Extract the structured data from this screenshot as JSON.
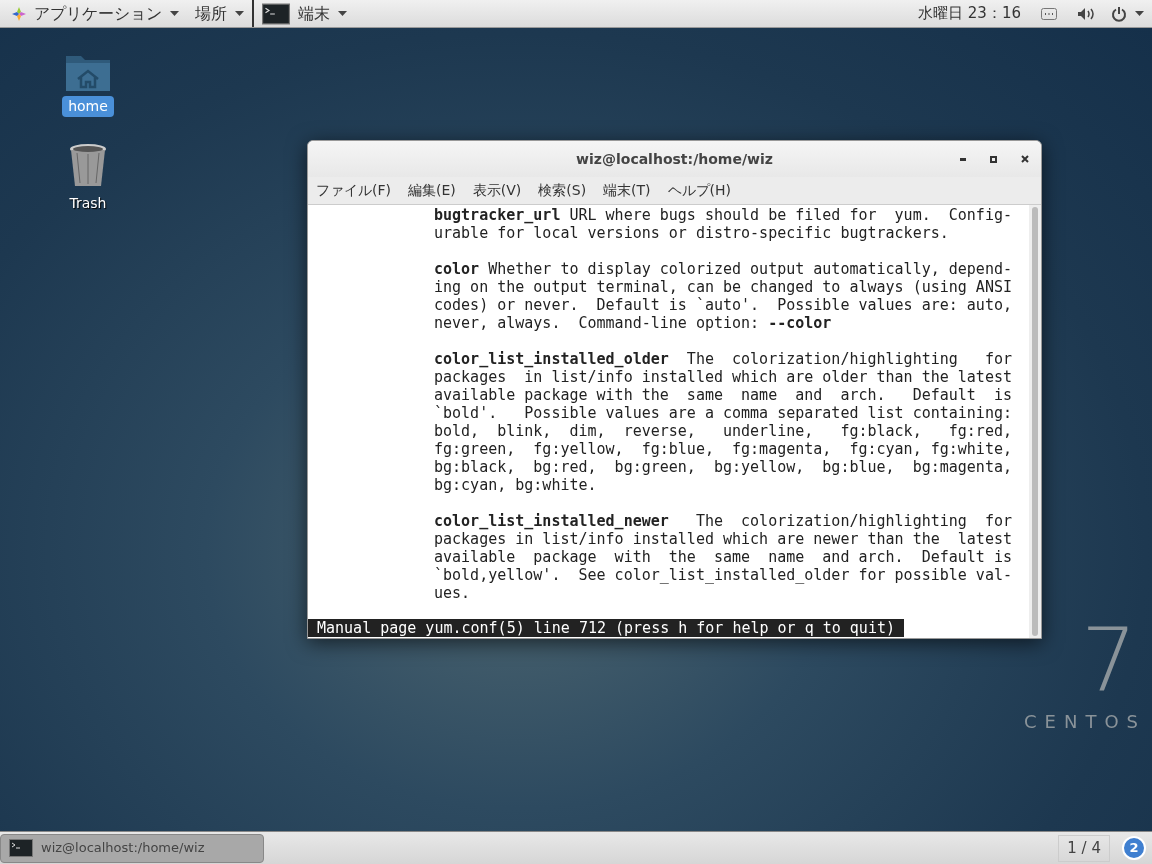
{
  "top_bar": {
    "menus": [
      {
        "label": "アプリケーション",
        "kind": "apps"
      },
      {
        "label": "場所",
        "kind": "plain"
      },
      {
        "label": "端末",
        "kind": "app"
      }
    ],
    "clock": "水曜日 23：16"
  },
  "desktop_icons": [
    {
      "label": "home",
      "kind": "folder",
      "selected": true
    },
    {
      "label": "Trash",
      "kind": "trash",
      "selected": false
    }
  ],
  "window": {
    "title": "wiz@localhost:/home/wiz",
    "menus": [
      "ファイル(F)",
      "編集(E)",
      "表示(V)",
      "検索(S)",
      "端末(T)",
      "ヘルプ(H)"
    ],
    "paragraphs": [
      [
        "**bugtracker_url** URL where bugs should be filed for  yum.  Config-",
        "urable for local versions or distro-specific bugtrackers."
      ],
      [
        "**color** Whether to display colorized output automatically, depend-",
        "ing on the output terminal, can be changed to always (using ANSI",
        "codes) or never.  Default is `auto'.  Possible values are: auto,",
        "never, always.  Command-line option: **--color**"
      ],
      [
        "**color_list_installed_older**  The  colorization/highlighting   for",
        "packages  in list/info installed which are older than the latest",
        "available package with the  same  name  and  arch.   Default  is",
        "`bold'.   Possible values are a comma separated list containing:",
        "bold,  blink,  dim,  reverse,   underline,   fg:black,   fg:red,",
        "fg:green,  fg:yellow,  fg:blue,  fg:magenta,  fg:cyan, fg:white,",
        "bg:black,  bg:red,  bg:green,  bg:yellow,  bg:blue,  bg:magenta,",
        "bg:cyan, bg:white."
      ],
      [
        "**color_list_installed_newer**   The  colorization/highlighting  for",
        "packages in list/info installed which are newer than the  latest",
        "available  package  with  the  same  name  and arch.  Default is",
        "`bold,yellow'.  See color_list_installed_older for possible val-",
        "ues."
      ]
    ],
    "status_line": "Manual page yum.conf(5) line 712 (press h for help or q to quit)"
  },
  "branding": {
    "number": "7",
    "name": "CENTOS"
  },
  "taskbar": {
    "tasks": [
      {
        "label": "wiz@localhost:/home/wiz",
        "selected": true
      }
    ],
    "workspace": "1 / 4",
    "notifications": "2"
  }
}
